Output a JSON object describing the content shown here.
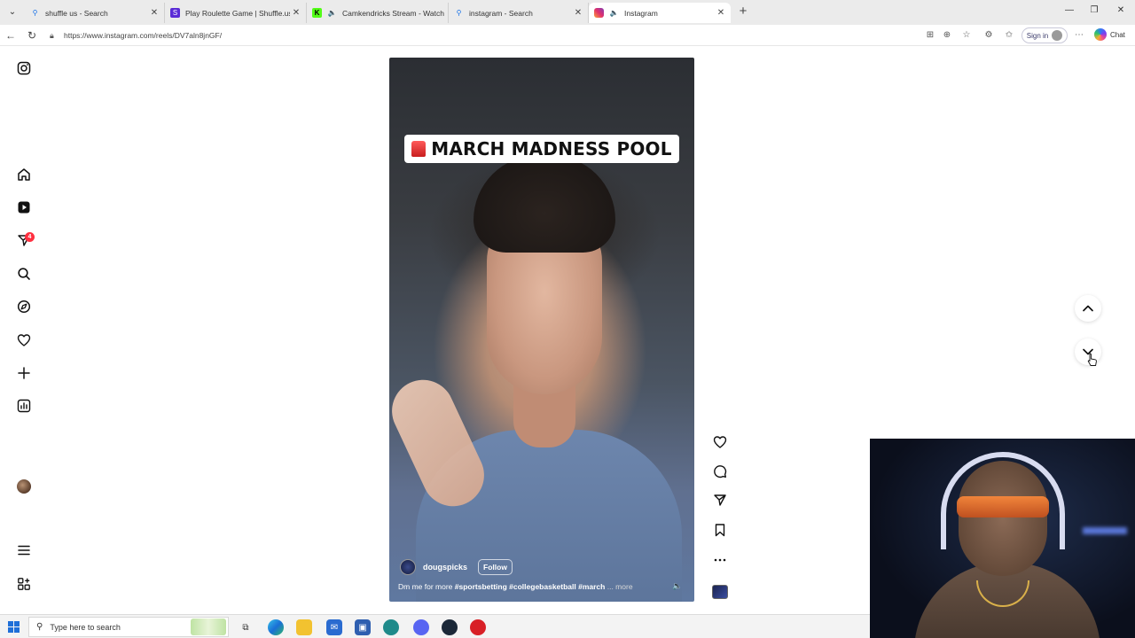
{
  "browser": {
    "tabs": [
      {
        "label": "shuffle us - Search",
        "icon": "search-icon"
      },
      {
        "label": "Play Roulette Game | Shuffle.us | T",
        "icon": "shuffle-icon"
      },
      {
        "label": "Camkendricks Stream - Watch",
        "icon": "kick-icon"
      },
      {
        "label": "instagram - Search",
        "icon": "search-icon"
      },
      {
        "label": "Instagram",
        "icon": "instagram-icon"
      }
    ],
    "url": "https://www.instagram.com/reels/DV7aln8jnGF/",
    "sign_in_label": "Sign in",
    "copilot_label": "Chat"
  },
  "reel": {
    "banner_text": "MARCH MADNESS POOL",
    "username": "dougspicks",
    "follow_label": "Follow",
    "caption_lead": "Dm me for more ",
    "caption_tags": "#sportsbetting #collegebasketball #march",
    "caption_more": "... more"
  },
  "sidebar": {
    "notification_count": "4"
  },
  "taskbar": {
    "search_placeholder": "Type here to search"
  },
  "colors": {
    "badge": "#ff3040",
    "windows_accent": "#1f6fd8"
  }
}
